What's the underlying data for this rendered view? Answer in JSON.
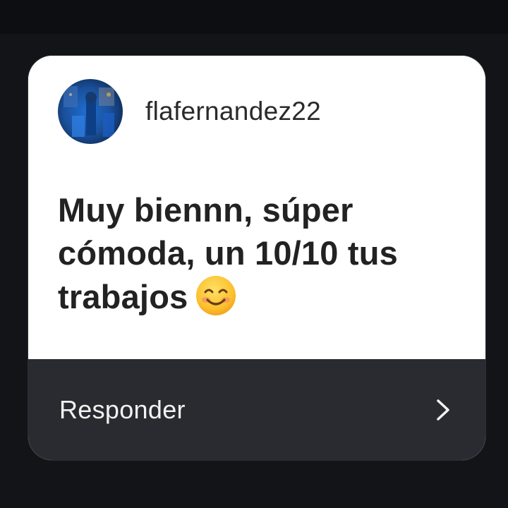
{
  "story_reply": {
    "username": "flafernandez22",
    "message": "Muy biennn, súper cómoda, un 10/10 tus trabajos",
    "emoji_icon": "smiling-face-icon",
    "reply_label": "Responder",
    "reply_icon": "chevron-right-icon"
  },
  "colors": {
    "background": "#121418",
    "card": "#ffffff",
    "reply_bar": "#2a2b30",
    "text_dark": "#222222",
    "text_light": "#f2f2f2"
  }
}
